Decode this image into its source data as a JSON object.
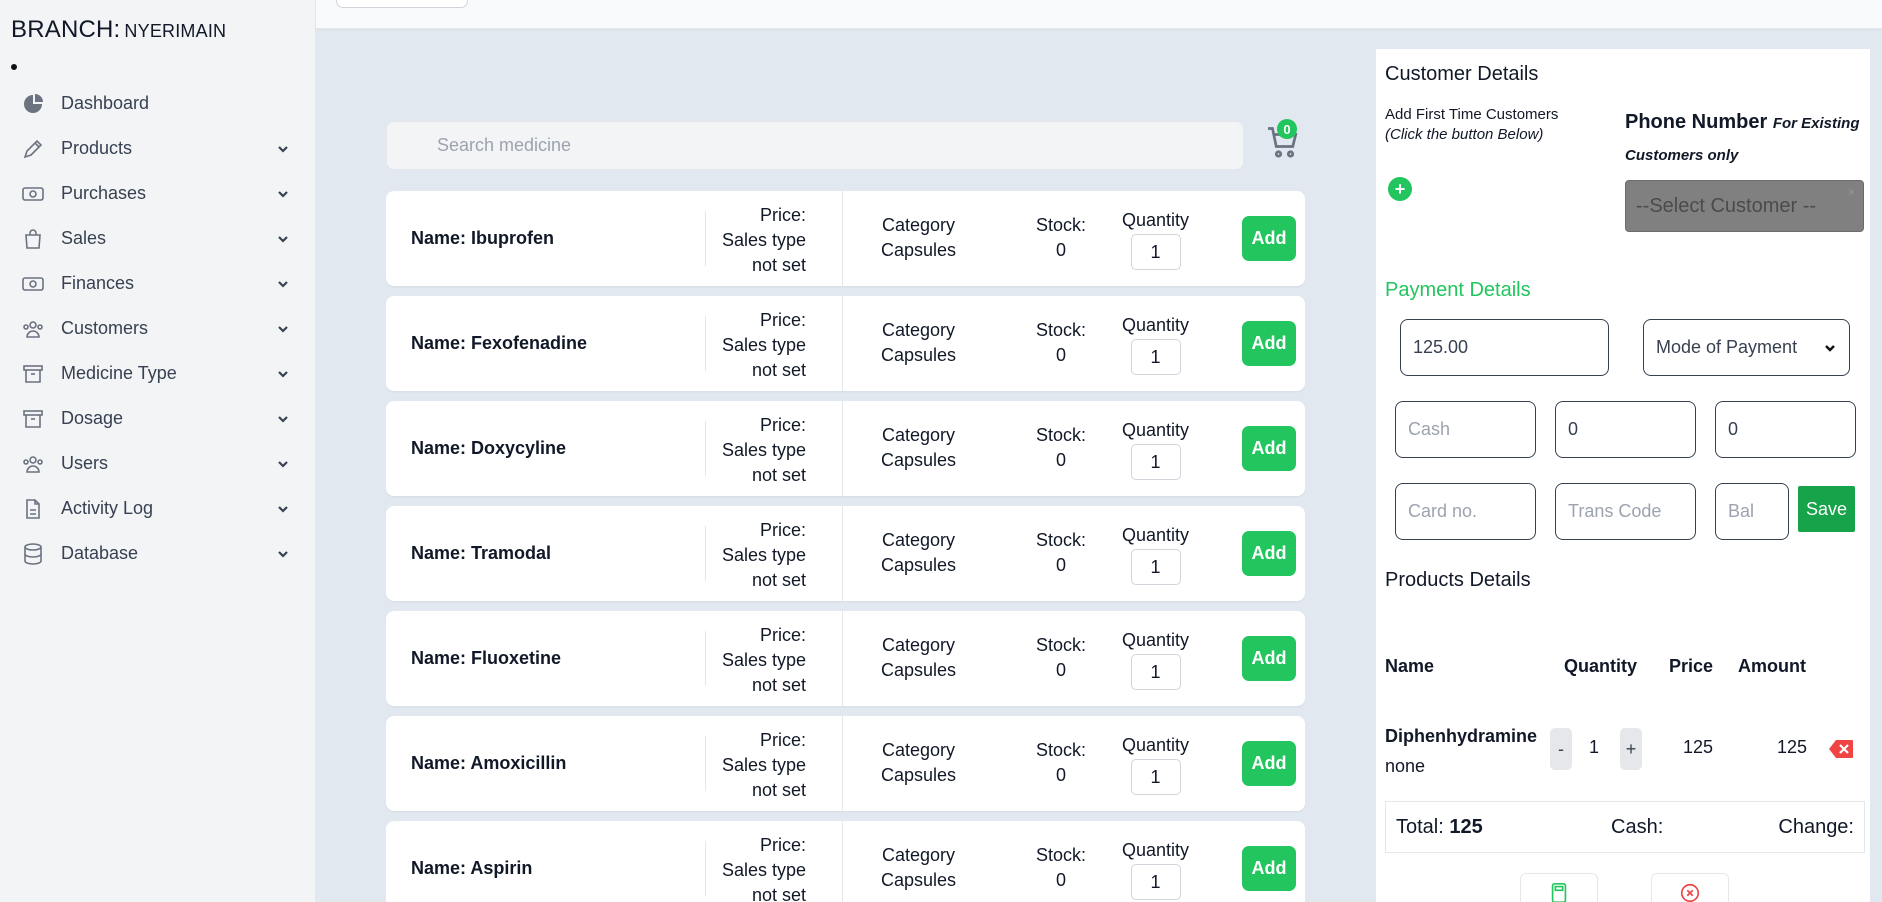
{
  "sidebar": {
    "branch_label": "BRANCH:",
    "branch_name": "NYERIMAIN",
    "items": [
      {
        "label": "Dashboard",
        "icon": "pie-chart-icon",
        "has_chevron": false
      },
      {
        "label": "Products",
        "icon": "pen-icon",
        "has_chevron": true
      },
      {
        "label": "Purchases",
        "icon": "banknote-icon",
        "has_chevron": true
      },
      {
        "label": "Sales",
        "icon": "shopping-bag-icon",
        "has_chevron": true
      },
      {
        "label": "Finances",
        "icon": "banknote-icon",
        "has_chevron": true
      },
      {
        "label": "Customers",
        "icon": "users-icon",
        "has_chevron": true
      },
      {
        "label": "Medicine Type",
        "icon": "archive-icon",
        "has_chevron": true
      },
      {
        "label": "Dosage",
        "icon": "archive-icon",
        "has_chevron": true
      },
      {
        "label": "Users",
        "icon": "users-icon",
        "has_chevron": true
      },
      {
        "label": "Activity Log",
        "icon": "document-icon",
        "has_chevron": true
      },
      {
        "label": "Database",
        "icon": "database-icon",
        "has_chevron": true
      }
    ]
  },
  "search": {
    "placeholder": "Search medicine"
  },
  "cart": {
    "count": "0"
  },
  "products": [
    {
      "name": "Name: Ibuprofen",
      "price_line1": "Price:",
      "price_line2": "Sales type",
      "price_line3": "not set",
      "cat_label": "Category",
      "cat_value": "Capsules",
      "stock_label": "Stock:",
      "stock_value": "0",
      "qty_label": "Quantity",
      "qty_value": "1",
      "add_label": "Add"
    },
    {
      "name": "Name: Fexofenadine",
      "price_line1": "Price:",
      "price_line2": "Sales type",
      "price_line3": "not set",
      "cat_label": "Category",
      "cat_value": "Capsules",
      "stock_label": "Stock:",
      "stock_value": "0",
      "qty_label": "Quantity",
      "qty_value": "1",
      "add_label": "Add"
    },
    {
      "name": "Name: Doxycyline",
      "price_line1": "Price:",
      "price_line2": "Sales type",
      "price_line3": "not set",
      "cat_label": "Category",
      "cat_value": "Capsules",
      "stock_label": "Stock:",
      "stock_value": "0",
      "qty_label": "Quantity",
      "qty_value": "1",
      "add_label": "Add"
    },
    {
      "name": "Name: Tramodal",
      "price_line1": "Price:",
      "price_line2": "Sales type",
      "price_line3": "not set",
      "cat_label": "Category",
      "cat_value": "Capsules",
      "stock_label": "Stock:",
      "stock_value": "0",
      "qty_label": "Quantity",
      "qty_value": "1",
      "add_label": "Add"
    },
    {
      "name": "Name: Fluoxetine",
      "price_line1": "Price:",
      "price_line2": "Sales type",
      "price_line3": "not set",
      "cat_label": "Category",
      "cat_value": "Capsules",
      "stock_label": "Stock:",
      "stock_value": "0",
      "qty_label": "Quantity",
      "qty_value": "1",
      "add_label": "Add"
    },
    {
      "name": "Name: Amoxicillin",
      "price_line1": "Price:",
      "price_line2": "Sales type",
      "price_line3": "not set",
      "cat_label": "Category",
      "cat_value": "Capsules",
      "stock_label": "Stock:",
      "stock_value": "0",
      "qty_label": "Quantity",
      "qty_value": "1",
      "add_label": "Add"
    },
    {
      "name": "Name: Aspirin",
      "price_line1": "Price:",
      "price_line2": "Sales type",
      "price_line3": "not set",
      "cat_label": "Category",
      "cat_value": "Capsules",
      "stock_label": "Stock:",
      "stock_value": "0",
      "qty_label": "Quantity",
      "qty_value": "1",
      "add_label": "Add"
    }
  ],
  "customer": {
    "title": "Customer Details",
    "add_first_line1": "Add First Time Customers",
    "add_first_line2": "(Click the button Below)",
    "add_button_glyph": "+",
    "phone_label": "Phone Number",
    "phone_note": "For Existing Customers only",
    "select_placeholder": "--Select Customer --",
    "select_clear": "×"
  },
  "payment": {
    "title": "Payment Details",
    "amount": "125.00",
    "mode_placeholder": "Mode of Payment",
    "cash_placeholder": "Cash",
    "field2_value": "0",
    "field3_value": "0",
    "card_placeholder": "Card no.",
    "trans_placeholder": "Trans Code",
    "bal_placeholder": "Bal",
    "save_label": "Save"
  },
  "products_details": {
    "title": "Products Details",
    "headers": {
      "name": "Name",
      "quantity": "Quantity",
      "price": "Price",
      "amount": "Amount"
    },
    "rows": [
      {
        "name": "Diphenhydramine",
        "sub": "none",
        "minus": "-",
        "quantity": "1",
        "plus": "+",
        "price": "125",
        "amount": "125"
      }
    ],
    "total_label": "Total:",
    "total_value": "125",
    "cash_label": "Cash:",
    "change_label": "Change:"
  },
  "colors": {
    "accent_green": "#22c55e",
    "save_green": "#16a34a",
    "delete_red": "#ef4444",
    "bg": "#e2e8f0"
  }
}
